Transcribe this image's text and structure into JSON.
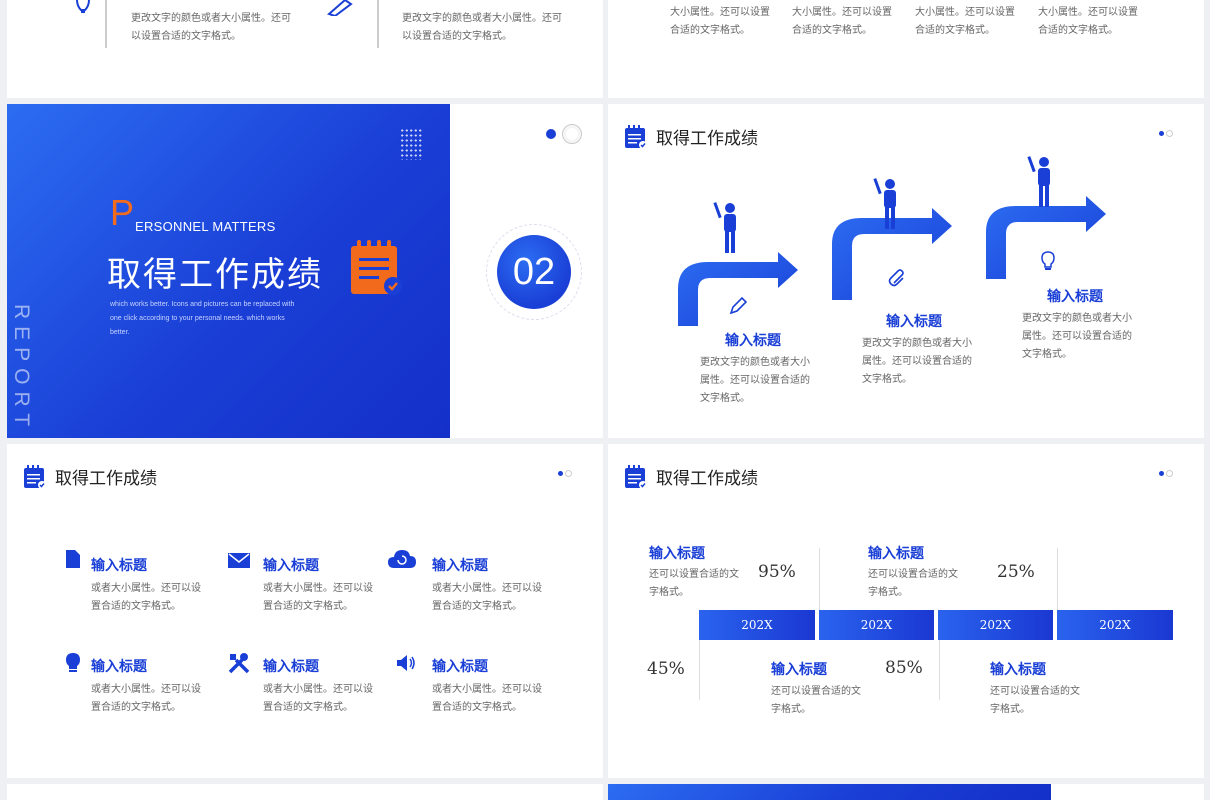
{
  "top_left": {
    "desc_1": "更改文字的颜色或者大小属性。还可以设置合适的文字格式。",
    "desc_2": "更改文字的颜色或者大小属性。还可以设置合适的文字格式。"
  },
  "top_right": {
    "cols": [
      "大小属性。还可以设置合适的文字格式。",
      "大小属性。还可以设置合适的文字格式。",
      "大小属性。还可以设置合适的文字格式。",
      "大小属性。还可以设置合适的文字格式。"
    ]
  },
  "cover": {
    "letter": "P",
    "subtitle": "ERSONNEL MATTERS",
    "title": "取得工作成绩",
    "body": "which works better. Icons and pictures can be replaced with one click according to your personal needs. which works better.",
    "vertical": "REPORT",
    "number": "02"
  },
  "arrows_slide": {
    "title": "取得工作成绩",
    "steps": [
      {
        "heading": "输入标题",
        "text": "更改文字的颜色或者大小属性。还可以设置合适的文字格式。",
        "icon": "pencil-icon"
      },
      {
        "heading": "输入标题",
        "text": "更改文字的颜色或者大小属性。还可以设置合适的文字格式。",
        "icon": "paperclip-icon"
      },
      {
        "heading": "输入标题",
        "text": "更改文字的颜色或者大小属性。还可以设置合适的文字格式。",
        "icon": "lightbulb-icon"
      }
    ]
  },
  "icons_slide": {
    "title": "取得工作成绩",
    "items": [
      {
        "heading": "输入标题",
        "text": "或者大小属性。还可以设置合适的文字格式。",
        "icon": "document-icon"
      },
      {
        "heading": "输入标题",
        "text": "或者大小属性。还可以设置合适的文字格式。",
        "icon": "mail-icon"
      },
      {
        "heading": "输入标题",
        "text": "或者大小属性。还可以设置合适的文字格式。",
        "icon": "cloud-icon"
      },
      {
        "heading": "输入标题",
        "text": "或者大小属性。还可以设置合适的文字格式。",
        "icon": "lightbulb-icon"
      },
      {
        "heading": "输入标题",
        "text": "或者大小属性。还可以设置合适的文字格式。",
        "icon": "tools-icon"
      },
      {
        "heading": "输入标题",
        "text": "或者大小属性。还可以设置合适的文字格式。",
        "icon": "speaker-icon"
      }
    ]
  },
  "timeline_slide": {
    "title": "取得工作成绩",
    "top": [
      {
        "heading": "输入标题",
        "text": "还可以设置合适的文字格式。",
        "pct": "95%"
      },
      {
        "heading": "输入标题",
        "text": "还可以设置合适的文字格式。",
        "pct": "25%"
      }
    ],
    "years": [
      "202X",
      "202X",
      "202X",
      "202X"
    ],
    "bottom": [
      {
        "heading": "输入标题",
        "text": "还可以设置合适的文字格式。",
        "pct": "85%"
      },
      {
        "heading": "输入标题",
        "text": "还可以设置合适的文字格式。"
      }
    ],
    "left_pct": "45%"
  },
  "colors": {
    "accent": "#1a3fd6",
    "orange": "#f26b1d",
    "bg": "#eef0f4"
  }
}
